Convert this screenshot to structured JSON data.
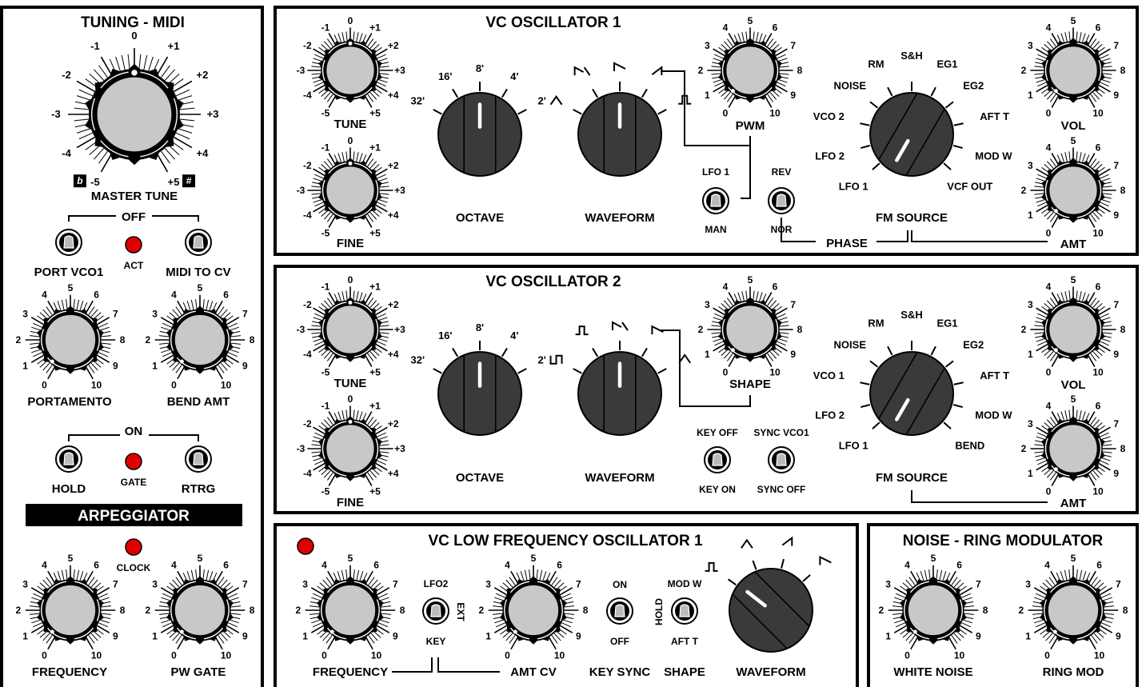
{
  "panels": {
    "tuning_midi": {
      "title": "TUNING - MIDI",
      "master_tune": {
        "label": "MASTER TUNE",
        "ticks": [
          "-5",
          "-4",
          "-3",
          "-2",
          "-1",
          "0",
          "+1",
          "+2",
          "+3",
          "+4",
          "+5"
        ],
        "flat_symbol": "b",
        "sharp_symbol": "#"
      },
      "off_label": "OFF",
      "port_vco1": "PORT VCO1",
      "act_label": "ACT",
      "midi_to_cv": "MIDI TO CV",
      "portamento": "PORTAMENTO",
      "bend_amt": "BEND AMT",
      "on_label": "ON",
      "hold": "HOLD",
      "gate_label": "GATE",
      "rtrg": "RTRG",
      "arpeggiator": "ARPEGGIATOR",
      "clock_label": "CLOCK",
      "frequency": "FREQUENCY",
      "pw_gate": "PW GATE"
    },
    "vco1": {
      "title": "VC OSCILLATOR 1",
      "tune": "TUNE",
      "fine": "FINE",
      "octave": "OCTAVE",
      "octave_ticks": [
        "32'",
        "16'",
        "8'",
        "4'",
        "2'"
      ],
      "waveform": "WAVEFORM",
      "pwm": "PWM",
      "lfo1": "LFO 1",
      "man": "MAN",
      "rev": "REV",
      "nor": "NOR",
      "phase": "PHASE",
      "fm_source": "FM SOURCE",
      "fm_sources": [
        "LFO 1",
        "LFO 2",
        "VCO 2",
        "NOISE",
        "RM",
        "S&H",
        "EG1",
        "EG2",
        "AFT T",
        "MOD W",
        "VCF OUT"
      ],
      "vol": "VOL",
      "amt": "AMT"
    },
    "vco2": {
      "title": "VC OSCILLATOR 2",
      "tune": "TUNE",
      "fine": "FINE",
      "octave": "OCTAVE",
      "octave_ticks": [
        "32'",
        "16'",
        "8'",
        "4'",
        "2'"
      ],
      "waveform": "WAVEFORM",
      "shape": "SHAPE",
      "key_off": "KEY OFF",
      "key_on": "KEY ON",
      "sync_vco1": "SYNC VCO1",
      "sync_off": "SYNC OFF",
      "fm_source": "FM SOURCE",
      "fm_sources": [
        "LFO 1",
        "LFO 2",
        "VCO 1",
        "NOISE",
        "RM",
        "S&H",
        "EG1",
        "EG2",
        "AFT T",
        "MOD W",
        "BEND"
      ],
      "vol": "VOL",
      "amt": "AMT"
    },
    "lfo1": {
      "title": "VC LOW FREQUENCY OSCILLATOR 1",
      "frequency": "FREQUENCY",
      "lfo2": "LFO2",
      "ext": "EXT",
      "key": "KEY",
      "amt_cv": "AMT CV",
      "on": "ON",
      "off": "OFF",
      "key_sync": "KEY SYNC",
      "mod_w": "MOD W",
      "hold": "HOLD",
      "aft_t": "AFT T",
      "shape": "SHAPE",
      "waveform": "WAVEFORM"
    },
    "noise_ring": {
      "title": "NOISE - RING MODULATOR",
      "white_noise": "WHITE NOISE",
      "ring_mod": "RING MOD"
    }
  },
  "scale_0_10": [
    "0",
    "1",
    "2",
    "3",
    "4",
    "5",
    "6",
    "7",
    "8",
    "9",
    "10"
  ],
  "scale_tune": [
    "-5",
    "-4",
    "-3",
    "-2",
    "-1",
    "0",
    "+1",
    "+2",
    "+3",
    "+4",
    "+5"
  ],
  "colors": {
    "led": "#e00000",
    "knob_face": "#c8c8c8",
    "selector": "#3a3a3a"
  }
}
